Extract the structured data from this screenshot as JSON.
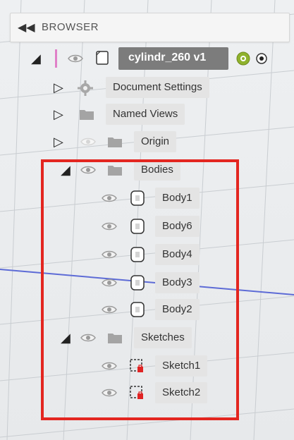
{
  "browser": {
    "collapse_glyph": "◀◀",
    "title": "BROWSER"
  },
  "document": {
    "name": "cylindr_260 v1",
    "icons": [
      "triangle-expanded-icon",
      "eye-icon",
      "component-box-icon",
      "target-gear-icon",
      "radio-icon"
    ]
  },
  "tree": {
    "document_settings": "Document Settings",
    "named_views": "Named Views",
    "origin": "Origin",
    "bodies": "Bodies",
    "bodies_items": [
      "Body1",
      "Body6",
      "Body4",
      "Body3",
      "Body2"
    ],
    "sketches": "Sketches",
    "sketch_items": [
      "Sketch1",
      "Sketch2"
    ]
  },
  "colors": {
    "highlight_box": "#e32620",
    "title_bg": "#7c7c7c",
    "pill_bg": "#e4e4e4",
    "accent_green": "#8fb22d"
  }
}
